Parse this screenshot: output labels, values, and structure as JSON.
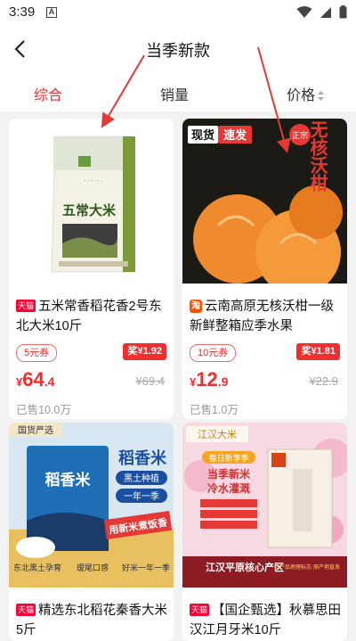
{
  "status": {
    "time": "3:39",
    "a_label": "A"
  },
  "header": {
    "title": "当季新款"
  },
  "tabs": [
    {
      "label": "综合",
      "active": true
    },
    {
      "label": "销量",
      "active": false
    },
    {
      "label": "价格",
      "active": false
    }
  ],
  "products": [
    {
      "badge": "天猫",
      "name": "五米常香稻花香2号东北大米10斤",
      "coupon": "5元券",
      "reward": "奖¥1.92",
      "price_cur": "¥",
      "price_int": "64",
      "price_dec": ".4",
      "orig": "¥69.4",
      "sold": "已售10.0万",
      "img_text": "五常大米"
    },
    {
      "badge": "淘",
      "name": "云南高原无核沃柑一级新鲜整箱应季水果",
      "coupon": "10元券",
      "reward": "奖¥1.81",
      "price_cur": "¥",
      "price_int": "12",
      "price_dec": ".9",
      "orig": "¥22.9",
      "sold": "已售1.0万",
      "img_tag1": "现货",
      "img_tag2": "速发",
      "img_seal": "正宗",
      "img_title": "无核沃柑"
    },
    {
      "badge": "天猫",
      "name": "精选东北稻花秦香大米5斤",
      "img_corner": "国货严选",
      "img_title": "稻香米",
      "img_sub1": "黑土种植",
      "img_sub2": "一年一季",
      "img_bag": "稻香米",
      "img_slogan": "用新米煮饭香",
      "img_b1": "东北黑土孕育",
      "img_b2": "瑷尾口感",
      "img_b3": "好米一年一季"
    },
    {
      "badge": "天猫",
      "name": "【国企甄选】秋慕思田汉江月牙米10斤",
      "img_brand": "江汉大米",
      "img_t1": "当季新米",
      "img_t2": "冷水灌溉",
      "img_head": "春日新享季",
      "img_foot": "江汉平原核心产区",
      "img_foot2": "农产品地理标志·原产地直发"
    }
  ]
}
